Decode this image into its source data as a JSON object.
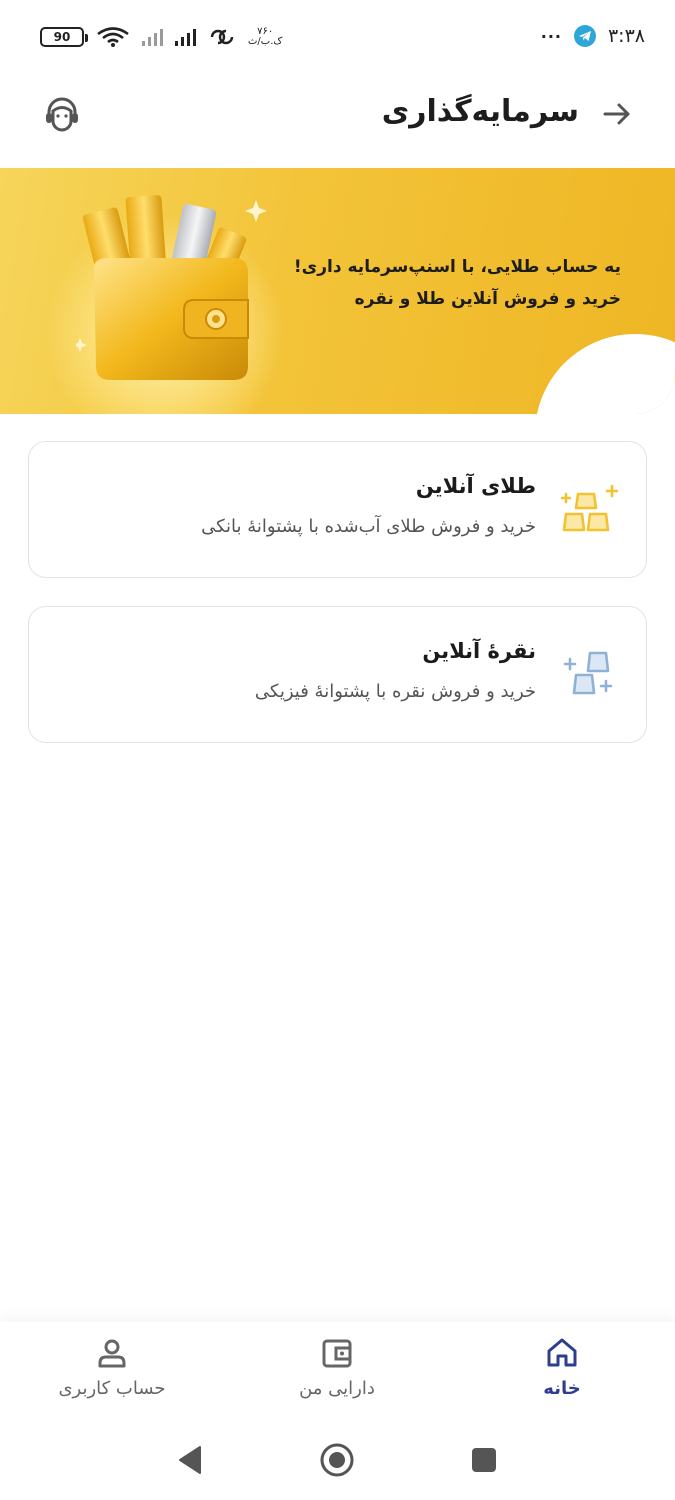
{
  "status_bar": {
    "battery": "90",
    "speed_value": "۷۶۰",
    "speed_unit": "ک.ب/ث",
    "time": "۳:۳۸",
    "more": "···",
    "icons": [
      "battery-icon",
      "wifi-icon",
      "signal-icon",
      "data-icon",
      "telegram-icon"
    ]
  },
  "header": {
    "title": "سرمایه‌گذاری",
    "back_icon": "arrow-right-icon",
    "support_icon": "support-headset-icon"
  },
  "banner": {
    "line1_prefix": "یه حساب طلایی، با ",
    "line1_brand": "اسنپ‌سرمایه",
    "line1_suffix": " داری!",
    "line2": "خرید و فروش آنلاین طلا و نقره",
    "image": "gold-wallet-illustration"
  },
  "products": [
    {
      "title": "طلای آنلاین",
      "subtitle": "خرید و فروش طلای آب‌شده با پشتوانۀ بانکی",
      "icon": "gold-bars-icon",
      "color": "#f2c230"
    },
    {
      "title": "نقرۀ آنلاین",
      "subtitle": "خرید و فروش نقره با پشتوانۀ فیزیکی",
      "icon": "silver-bars-icon",
      "color": "#8fb1d6"
    }
  ],
  "bottom_nav": {
    "home": "خانه",
    "assets": "دارایی من",
    "account": "حساب کاربری",
    "active_color": "#2f3d8f"
  }
}
